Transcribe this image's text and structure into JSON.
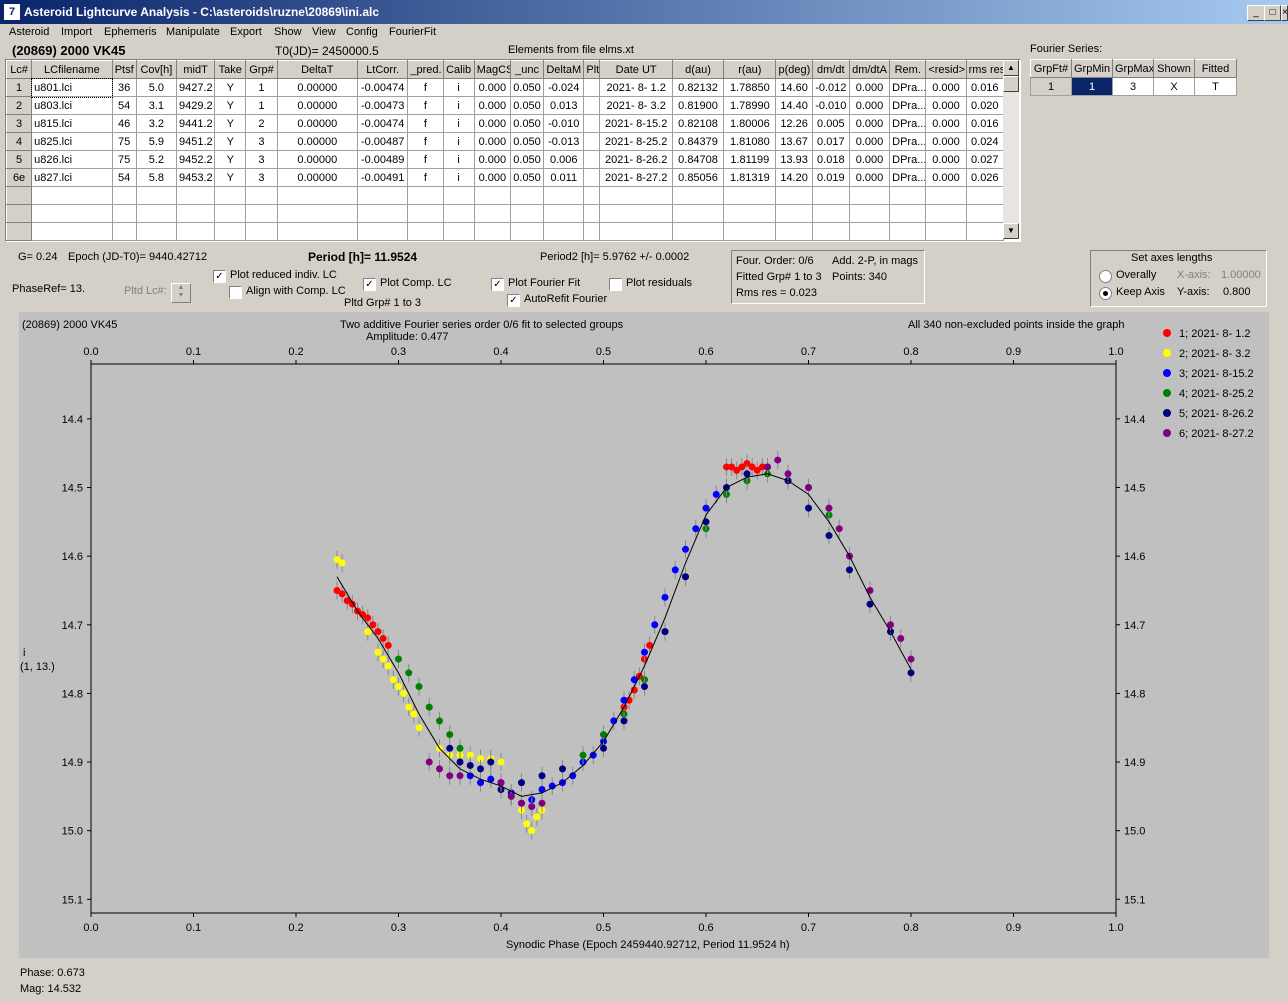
{
  "window": {
    "title": "Asteroid Lightcurve Analysis - C:\\asteroids\\ruzne\\20869\\ini.alc",
    "min": "_",
    "max": "□",
    "close": "×"
  },
  "menu": [
    "Asteroid",
    "Import",
    "Ephemeris",
    "Manipulate",
    "Export",
    "Show",
    "View",
    "Config",
    "FourierFit"
  ],
  "header": {
    "asteroid": "(20869) 2000 VK45",
    "t0": "T0(JD)= 2450000.5",
    "elements": "Elements from file elms.xt",
    "fourier_series_label": "Fourier Series:"
  },
  "lc_table": {
    "columns": [
      "Lc#",
      "LCfilename",
      "Ptsf",
      "Cov[h]",
      "midT",
      "Take",
      "Grp#",
      "DeltaT",
      "LtCorr.",
      "_pred.",
      "Calib",
      "MagCS",
      "_unc",
      "DeltaM",
      "Plt",
      "Date UT",
      "d(au)",
      "r(au)",
      "p(deg)",
      "dm/dt",
      "dm/dtA",
      "Rem.",
      "<resid>",
      "rms res"
    ],
    "rows": [
      [
        "1",
        "u801.lci",
        "36",
        "5.0",
        "9427.2",
        "Y",
        "1",
        "0.00000",
        "-0.00474",
        "f",
        "i",
        "0.000",
        "0.050",
        "-0.024",
        "",
        "2021- 8- 1.2",
        "0.82132",
        "1.78850",
        "14.60",
        "-0.012",
        "0.000",
        "DPra...",
        "0.000",
        "0.016"
      ],
      [
        "2",
        "u803.lci",
        "54",
        "3.1",
        "9429.2",
        "Y",
        "1",
        "0.00000",
        "-0.00473",
        "f",
        "i",
        "0.000",
        "0.050",
        "0.013",
        "",
        "2021- 8- 3.2",
        "0.81900",
        "1.78990",
        "14.40",
        "-0.010",
        "0.000",
        "DPra...",
        "0.000",
        "0.020"
      ],
      [
        "3",
        "u815.lci",
        "46",
        "3.2",
        "9441.2",
        "Y",
        "2",
        "0.00000",
        "-0.00474",
        "f",
        "i",
        "0.000",
        "0.050",
        "-0.010",
        "",
        "2021- 8-15.2",
        "0.82108",
        "1.80006",
        "12.26",
        "0.005",
        "0.000",
        "DPra...",
        "0.000",
        "0.016"
      ],
      [
        "4",
        "u825.lci",
        "75",
        "5.9",
        "9451.2",
        "Y",
        "3",
        "0.00000",
        "-0.00487",
        "f",
        "i",
        "0.000",
        "0.050",
        "-0.013",
        "",
        "2021- 8-25.2",
        "0.84379",
        "1.81080",
        "13.67",
        "0.017",
        "0.000",
        "DPra...",
        "0.000",
        "0.024"
      ],
      [
        "5",
        "u826.lci",
        "75",
        "5.2",
        "9452.2",
        "Y",
        "3",
        "0.00000",
        "-0.00489",
        "f",
        "i",
        "0.000",
        "0.050",
        "0.006",
        "",
        "2021- 8-26.2",
        "0.84708",
        "1.81199",
        "13.93",
        "0.018",
        "0.000",
        "DPra...",
        "0.000",
        "0.027"
      ],
      [
        "6e",
        "u827.lci",
        "54",
        "5.8",
        "9453.2",
        "Y",
        "3",
        "0.00000",
        "-0.00491",
        "f",
        "i",
        "0.000",
        "0.050",
        "0.011",
        "",
        "2021- 8-27.2",
        "0.85056",
        "1.81319",
        "14.20",
        "0.019",
        "0.000",
        "DPra...",
        "0.000",
        "0.026"
      ]
    ],
    "empty_rows": 3
  },
  "fourier_table": {
    "columns": [
      "GrpFt#",
      "GrpMin",
      "GrpMax",
      "Shown",
      "Fitted"
    ],
    "row": [
      "1",
      "1",
      "3",
      "X",
      "T"
    ]
  },
  "info": {
    "g": "G= 0.24",
    "epoch": "Epoch (JD-T0)= 9440.42712",
    "period": "Period [h]= 11.9524",
    "period2": "Period2 [h]= 5.9762 +/- 0.0002",
    "phaseref": "PhaseRef= 13.",
    "pltd_lc": "Pltd Lc#:",
    "pltd_grp": "Pltd Grp#  1   to   3"
  },
  "options": {
    "plot_reduced": "Plot reduced indiv. LC",
    "align_comp": "Align with Comp. LC",
    "plot_comp": "Plot Comp. LC",
    "plot_fourier": "Plot Fourier Fit",
    "autorefit": "AutoRefit Fourier",
    "plot_residuals": "Plot residuals",
    "check": "✓"
  },
  "fit_box": {
    "order": "Four. Order:  0/6",
    "add": "Add. 2-P, in mags",
    "fitted": "Fitted Grp# 1 to 3",
    "points": "Points: 340",
    "rms": "Rms res     = 0.023"
  },
  "axes_box": {
    "title": "Set axes lengths",
    "overally": "Overally",
    "keep": "Keep Axis",
    "xaxis_label": "X-axis:",
    "xaxis_value": "1.00000",
    "yaxis_label": "Y-axis:",
    "yaxis_value": "0.800"
  },
  "plot": {
    "name": "(20869) 2000 VK45",
    "subtitle": "Two additive Fourier series order 0/6 fit to selected groups",
    "amplitude": "Amplitude: 0.477",
    "points_note": "All 340 non-excluded points inside the graph",
    "ylabel_line1": "i",
    "ylabel_line2": "(1, 13.)",
    "xlabel": "Synodic Phase (Epoch 2459440.92712, Period 11.9524 h)",
    "bg_color": "#c0c0c0"
  },
  "status": {
    "phase": "Phase:  0.673",
    "mag": "Mag:    14.532"
  },
  "chart_data": {
    "type": "scatter",
    "xlim": [
      0.0,
      1.0
    ],
    "ylim": [
      15.12,
      14.32
    ],
    "xticks": [
      0.0,
      0.1,
      0.2,
      0.3,
      0.4,
      0.5,
      0.6,
      0.7,
      0.8,
      0.9,
      1.0
    ],
    "yticks": [
      14.4,
      14.5,
      14.6,
      14.7,
      14.8,
      14.9,
      15.0,
      15.1
    ],
    "series": [
      {
        "name": "1; 2021- 8- 1.2",
        "color": "#ff0000",
        "x": [
          0.24,
          0.245,
          0.25,
          0.255,
          0.26,
          0.265,
          0.27,
          0.275,
          0.28,
          0.285,
          0.29,
          0.52,
          0.525,
          0.53,
          0.535,
          0.54,
          0.545,
          0.62,
          0.625,
          0.63,
          0.635,
          0.64,
          0.645,
          0.65,
          0.655
        ],
        "y": [
          14.65,
          14.655,
          14.665,
          14.67,
          14.68,
          14.685,
          14.69,
          14.7,
          14.71,
          14.72,
          14.73,
          14.82,
          14.81,
          14.795,
          14.775,
          14.75,
          14.73,
          14.47,
          14.47,
          14.475,
          14.47,
          14.465,
          14.47,
          14.475,
          14.47
        ]
      },
      {
        "name": "2; 2021- 8- 3.2",
        "color": "#ffff00",
        "x": [
          0.24,
          0.245,
          0.27,
          0.28,
          0.285,
          0.29,
          0.295,
          0.3,
          0.305,
          0.31,
          0.315,
          0.32,
          0.34,
          0.35,
          0.36,
          0.37,
          0.38,
          0.39,
          0.4,
          0.41,
          0.42,
          0.425,
          0.43,
          0.435,
          0.44
        ],
        "y": [
          14.605,
          14.61,
          14.71,
          14.74,
          14.75,
          14.76,
          14.78,
          14.79,
          14.8,
          14.82,
          14.83,
          14.85,
          14.88,
          14.89,
          14.89,
          14.89,
          14.895,
          14.895,
          14.9,
          14.95,
          14.97,
          14.99,
          15.0,
          14.98,
          14.97
        ]
      },
      {
        "name": "3; 2021- 8-15.2",
        "color": "#0000ff",
        "x": [
          0.37,
          0.38,
          0.39,
          0.4,
          0.41,
          0.42,
          0.43,
          0.44,
          0.45,
          0.46,
          0.47,
          0.48,
          0.49,
          0.5,
          0.51,
          0.52,
          0.53,
          0.54,
          0.55,
          0.56,
          0.57,
          0.58,
          0.59,
          0.6,
          0.61
        ],
        "y": [
          14.92,
          14.93,
          14.925,
          14.93,
          14.945,
          14.96,
          14.955,
          14.94,
          14.935,
          14.93,
          14.92,
          14.9,
          14.89,
          14.87,
          14.84,
          14.81,
          14.78,
          14.74,
          14.7,
          14.66,
          14.62,
          14.59,
          14.56,
          14.53,
          14.51
        ]
      },
      {
        "name": "4; 2021- 8-25.2",
        "color": "#008000",
        "x": [
          0.3,
          0.31,
          0.32,
          0.33,
          0.34,
          0.35,
          0.36,
          0.48,
          0.5,
          0.52,
          0.54,
          0.56,
          0.58,
          0.6,
          0.62,
          0.64,
          0.66,
          0.68,
          0.7,
          0.72
        ],
        "y": [
          14.75,
          14.77,
          14.79,
          14.82,
          14.84,
          14.86,
          14.88,
          14.89,
          14.86,
          14.83,
          14.78,
          14.71,
          14.63,
          14.56,
          14.51,
          14.49,
          14.48,
          14.49,
          14.5,
          14.54
        ]
      },
      {
        "name": "5; 2021- 8-26.2",
        "color": "#000080",
        "x": [
          0.35,
          0.36,
          0.37,
          0.38,
          0.39,
          0.4,
          0.41,
          0.42,
          0.44,
          0.46,
          0.5,
          0.52,
          0.54,
          0.56,
          0.58,
          0.6,
          0.62,
          0.64,
          0.66,
          0.68,
          0.7,
          0.72,
          0.74,
          0.76,
          0.78,
          0.8
        ],
        "y": [
          14.88,
          14.9,
          14.905,
          14.91,
          14.9,
          14.94,
          14.95,
          14.93,
          14.92,
          14.91,
          14.88,
          14.84,
          14.79,
          14.71,
          14.63,
          14.55,
          14.5,
          14.48,
          14.47,
          14.49,
          14.53,
          14.57,
          14.62,
          14.67,
          14.71,
          14.77
        ]
      },
      {
        "name": "6; 2021- 8-27.2",
        "color": "#800080",
        "x": [
          0.33,
          0.34,
          0.35,
          0.36,
          0.4,
          0.41,
          0.42,
          0.43,
          0.44,
          0.66,
          0.67,
          0.68,
          0.7,
          0.72,
          0.73,
          0.74,
          0.76,
          0.78,
          0.79,
          0.8
        ],
        "y": [
          14.9,
          14.91,
          14.92,
          14.92,
          14.93,
          14.95,
          14.96,
          14.965,
          14.96,
          14.47,
          14.46,
          14.48,
          14.5,
          14.53,
          14.56,
          14.6,
          14.65,
          14.7,
          14.72,
          14.75
        ]
      }
    ],
    "fit": {
      "name": "Fourier fit",
      "color": "#000000",
      "x": [
        0.24,
        0.26,
        0.28,
        0.3,
        0.32,
        0.34,
        0.36,
        0.38,
        0.4,
        0.42,
        0.44,
        0.46,
        0.48,
        0.5,
        0.52,
        0.54,
        0.56,
        0.58,
        0.6,
        0.62,
        0.64,
        0.66,
        0.68,
        0.7,
        0.72,
        0.74,
        0.76,
        0.78,
        0.8
      ],
      "y": [
        14.63,
        14.68,
        14.72,
        14.77,
        14.83,
        14.88,
        14.91,
        14.925,
        14.935,
        14.95,
        14.945,
        14.93,
        14.905,
        14.87,
        14.82,
        14.76,
        14.69,
        14.61,
        14.54,
        14.5,
        14.485,
        14.48,
        14.49,
        14.51,
        14.55,
        14.6,
        14.66,
        14.71,
        14.765
      ]
    }
  }
}
